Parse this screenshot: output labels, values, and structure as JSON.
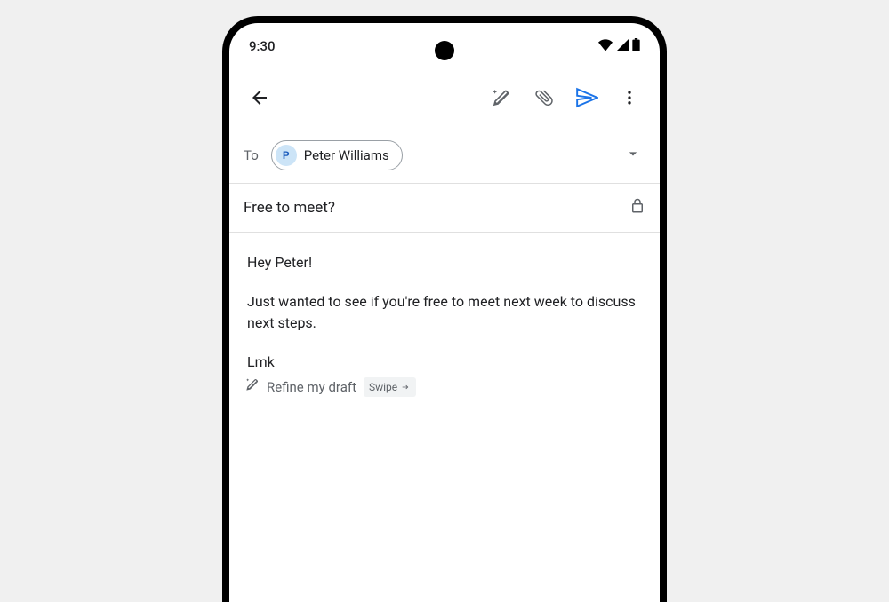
{
  "statusBar": {
    "time": "9:30"
  },
  "compose": {
    "toLabel": "To",
    "recipient": {
      "initial": "P",
      "name": "Peter Williams"
    },
    "subject": "Free to meet?",
    "body": {
      "greeting": "Hey Peter!",
      "paragraph": "Just wanted to see if you're free to meet next week to discuss next steps.",
      "closing": "Lmk"
    },
    "refine": {
      "label": "Refine my draft",
      "swipe": "Swipe"
    }
  }
}
